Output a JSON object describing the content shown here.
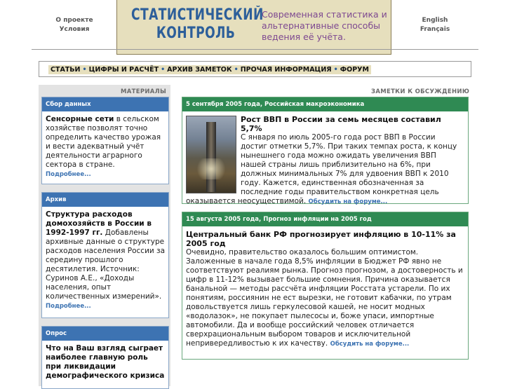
{
  "header": {
    "left_links": [
      "О проекте",
      "Условия"
    ],
    "logo_line1": "СТАТИСТИЧЕСКИЙ",
    "logo_line2": "КОНТРОЛЬ",
    "tagline": "Современная статистика и альтернативные способы ведения её учёта.",
    "languages": [
      "English",
      "Français"
    ]
  },
  "nav": {
    "items": [
      "СТАТЬИ",
      "ЦИФРЫ И РАСЧЁТ",
      "АРХИВ ЗАМЕТОК",
      "ПРОЧАЯ ИНФОРМАЦИЯ",
      "ФОРУМ"
    ],
    "separator": "•"
  },
  "left": {
    "title": "МАТЕРИАЛЫ",
    "boxes": [
      {
        "head": "Сбор данных",
        "bold": "Сенсорные сети",
        "text": " в сельском хозяйстве позволят точно определить качество урожая и вести адекватный учёт деятельности аграрного сектора в стране.",
        "more": "Подробнее..."
      },
      {
        "head": "Архив",
        "bold": "Структура расходов домохозяйств в России в 1992-1997 гг.",
        "text": " Добавлены архивные данные о структуре расходов населения России за середину прошлого десятилетия. Источник: Суринов А.Е., «Доходы населения, опыт количественных измерений».",
        "more": "Подробнее..."
      },
      {
        "head": "Опрос",
        "bold": "Что на Ваш взгляд сыграет наиболее главную роль при ликвидации демографического кризиса",
        "text": "",
        "more": ""
      }
    ]
  },
  "right": {
    "title": "ЗАМЕТКИ К ОБСУЖДЕНИЮ",
    "posts": [
      {
        "head": "5 сентября 2005 года, Российская макроэкономика",
        "title": "Рост ВВП в России за семь месяцев составил 5,7%",
        "text": "С января по июль 2005-го года рост ВВП в России достиг отметки 5,7%. При таких темпах роста, к концу нынешнего года можно ожидать увеличения ВВП нашей страны лишь приблизительно на 6%, при должных минимальных 7% для удвоения ВВП к 2010 году. Кажется, единственная обозначенная за последние годы правительством конкретная цель оказывается неосуществимой.",
        "more": "Обсудить на форуме..."
      },
      {
        "head": "15 августа 2005 года, Прогноз инфляции на 2005 год",
        "title": "Центральный банк РФ прогнозирует инфляцию в 10-11% за 2005 год",
        "text": "Очевидно, правительство оказалось большим оптимистом. Заложенные в начале года 8,5% инфляции в Бюджет РФ явно не соответствуют реалиям рынка. Прогноз прогнозом, а достоверность и цифр в 11-12% вызывает большие сомнения. Причина оказывается банальной — методы рассчёта инфляции Росстата устарели. По их понятиям, россиянин не ест вырезки, не готовит кабачки, по утрам довольствуется лишь геркулесовой кашей, не носит модных «водолазок», не покупает пылесосы и, боже упаси, импортные автомобили. Да и вообще российский человек отличается сверхрациональным выбором товаров и исключительной непривередливостью к их качеству.",
        "more": "Обсудить на форуме..."
      }
    ]
  },
  "colors": {
    "accent_blue": "#3d73b2",
    "accent_green": "#2f8a53",
    "logo_bg": "#e6dfbd",
    "tagline": "#7d4890"
  }
}
